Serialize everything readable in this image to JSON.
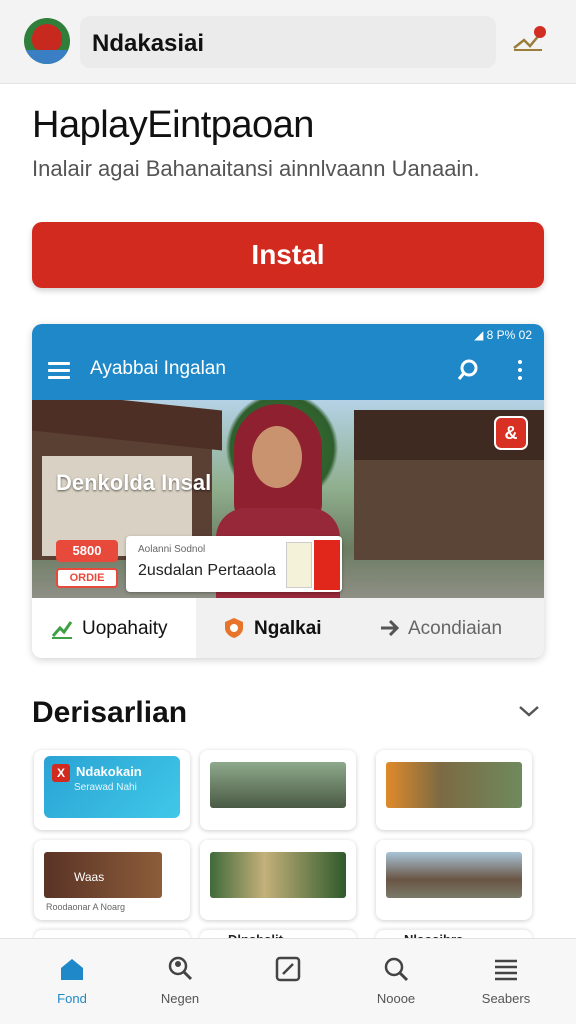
{
  "header": {
    "app_title": "Ndakasiai",
    "logo_icon": "app-logo",
    "notification_icon": "notification-icon"
  },
  "page": {
    "title": "HaplayEintpaoan",
    "subtitle": "Inalair agai Bahanaitansi ainnlvaann Uanaain.",
    "install_label": "Instal"
  },
  "preview_card": {
    "status_text": "◢ 8 P% 02",
    "bar_title": "Ayabbai Ingalan",
    "hero_label": "Denkolda Insal",
    "price_tag": "5800",
    "price_tag2": "ORDIE",
    "info_small": "Aolanni Sodnol",
    "info_main": "2usdalan Pertaaola",
    "tabs": [
      {
        "label": "Uopahaity",
        "icon": "chart-up-icon"
      },
      {
        "label": "Ngalkai",
        "icon": "shield-icon"
      },
      {
        "label": "Acondiaian",
        "icon": "arrow-right-icon"
      }
    ],
    "colors": {
      "accent": "#d32a1f",
      "bar": "#1f88c8"
    }
  },
  "section": {
    "title": "Derisarlian",
    "thumbs": [
      {
        "title": "Ndakokain",
        "caption": "Serawad Nahi"
      },
      {
        "title": "",
        "caption": ""
      },
      {
        "title": "",
        "caption": ""
      },
      {
        "title": "Waas",
        "caption": "Roodaonar A Noarg"
      },
      {
        "title": "",
        "caption": ""
      },
      {
        "title": "",
        "caption": ""
      }
    ],
    "row3": [
      "",
      "Dlnsbalit",
      "Nlaoaihra"
    ]
  },
  "bottom_nav": [
    {
      "label": "Fond",
      "icon": "home-icon"
    },
    {
      "label": "Negen",
      "icon": "search-person-icon"
    },
    {
      "label": "Noooe",
      "icon": "edit-icon"
    },
    {
      "label": "Noooe",
      "icon": "search-icon"
    },
    {
      "label": "Seabers",
      "icon": "menu-icon"
    }
  ]
}
